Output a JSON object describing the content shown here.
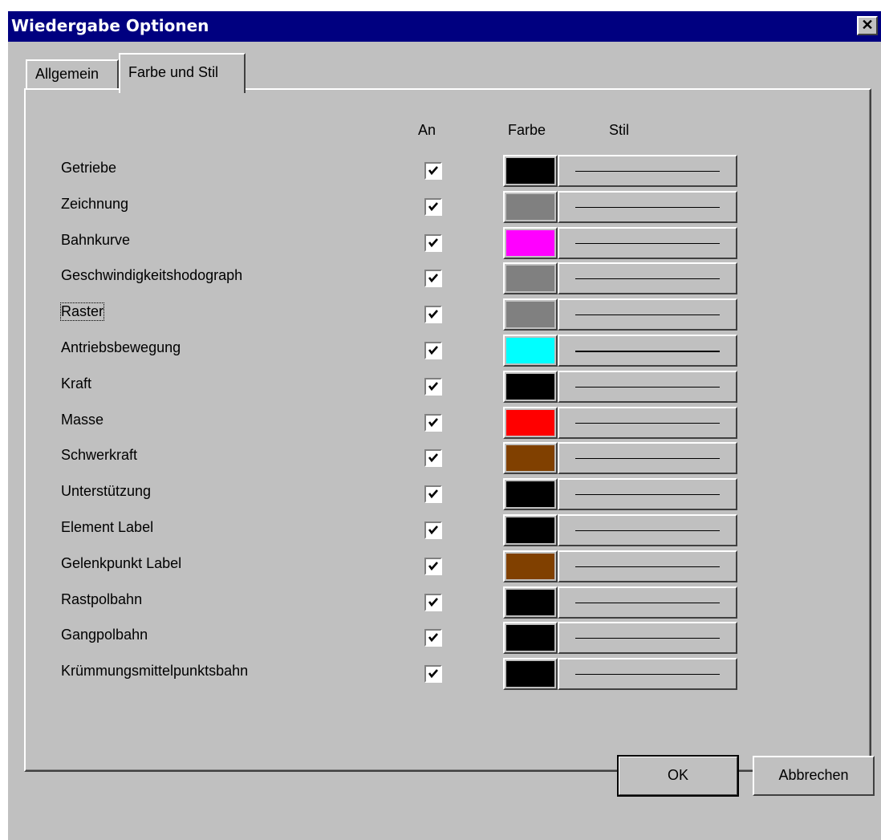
{
  "window": {
    "title": "Wiedergabe Optionen",
    "close_glyph": "✕"
  },
  "tabs": [
    {
      "label": "Allgemein",
      "active": false
    },
    {
      "label": "Farbe und Stil",
      "active": true
    }
  ],
  "columns": {
    "on": "An",
    "color": "Farbe",
    "style": "Stil"
  },
  "rows": [
    {
      "label": "Getriebe",
      "checked": true,
      "color": "#000000"
    },
    {
      "label": "Zeichnung",
      "checked": true,
      "color": "#808080"
    },
    {
      "label": "Bahnkurve",
      "checked": true,
      "color": "#ff00ff"
    },
    {
      "label": "Geschwindigkeitshodograph",
      "checked": true,
      "color": "#808080"
    },
    {
      "label": "Raster",
      "checked": true,
      "color": "#808080"
    },
    {
      "label": "Antriebsbewegung",
      "checked": true,
      "color": "#00ffff"
    },
    {
      "label": "Kraft",
      "checked": true,
      "color": "#000000"
    },
    {
      "label": "Masse",
      "checked": true,
      "color": "#ff0000"
    },
    {
      "label": "Schwerkraft",
      "checked": true,
      "color": "#804000"
    },
    {
      "label": "Unterstützung",
      "checked": true,
      "color": "#000000"
    },
    {
      "label": "Element Label",
      "checked": true,
      "color": "#000000"
    },
    {
      "label": "Gelenkpunkt Label",
      "checked": true,
      "color": "#804000"
    },
    {
      "label": "Rastpolbahn",
      "checked": true,
      "color": "#000000"
    },
    {
      "label": "Gangpolbahn",
      "checked": true,
      "color": "#000000"
    },
    {
      "label": "Krümmungsmittelpunktsbahn",
      "checked": true,
      "color": "#000000"
    }
  ],
  "buttons": {
    "ok": "OK",
    "cancel": "Abbrechen"
  },
  "icons": {
    "close": "close-icon",
    "check": "checkmark-icon",
    "line": "solid-line-icon"
  }
}
